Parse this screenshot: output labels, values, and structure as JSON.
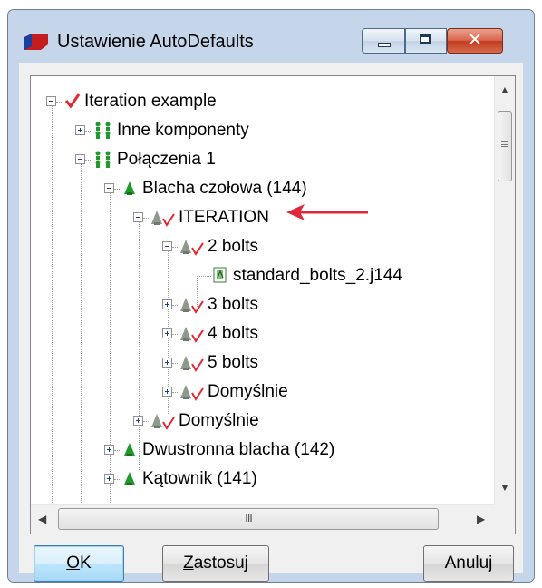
{
  "window": {
    "title": "Ustawienie AutoDefaults",
    "controls": {
      "minimize": "minimize",
      "maximize": "maximize",
      "close": "✕"
    }
  },
  "tree": {
    "items": [
      {
        "label": "Iteration example",
        "level": 0,
        "icon": "red-check-icon",
        "expander": "minus"
      },
      {
        "label": "Inne komponenty",
        "level": 1,
        "icon": "green-components-icon",
        "expander": "plus"
      },
      {
        "label": "Połączenia 1",
        "level": 1,
        "icon": "green-components-icon",
        "expander": "minus"
      },
      {
        "label": "Blacha czołowa (144)",
        "level": 2,
        "icon": "green-component-icon",
        "expander": "minus"
      },
      {
        "label": "ITERATION",
        "level": 3,
        "icon": "grey-check-icon",
        "expander": "minus"
      },
      {
        "label": "2 bolts",
        "level": 4,
        "icon": "grey-check-icon",
        "expander": "minus"
      },
      {
        "label": "standard_bolts_2.j144",
        "level": 5,
        "icon": "attribute-file-icon",
        "expander": "none"
      },
      {
        "label": "3 bolts",
        "level": 4,
        "icon": "grey-check-icon",
        "expander": "plus"
      },
      {
        "label": "4 bolts",
        "level": 4,
        "icon": "grey-check-icon",
        "expander": "plus"
      },
      {
        "label": "5 bolts",
        "level": 4,
        "icon": "grey-check-icon",
        "expander": "plus"
      },
      {
        "label": "Domyślnie",
        "level": 4,
        "icon": "grey-check-icon",
        "expander": "plus"
      },
      {
        "label": "Domyślnie",
        "level": 3,
        "icon": "grey-check-icon",
        "expander": "plus"
      },
      {
        "label": "Dwustronna blacha (142)",
        "level": 2,
        "icon": "green-component-icon",
        "expander": "plus"
      },
      {
        "label": "Kątownik (141)",
        "level": 2,
        "icon": "green-component-icon",
        "expander": "plus"
      }
    ],
    "hscroll_grip": "III"
  },
  "buttons": {
    "ok": {
      "accel": "O",
      "rest": "K"
    },
    "apply": {
      "accel": "Z",
      "rest": "astosuj"
    },
    "cancel": {
      "label": "Anuluj"
    }
  },
  "colors": {
    "annotation_arrow": "#e0283c",
    "check_red": "#e8252e",
    "component_green": "#1e9a2b"
  }
}
